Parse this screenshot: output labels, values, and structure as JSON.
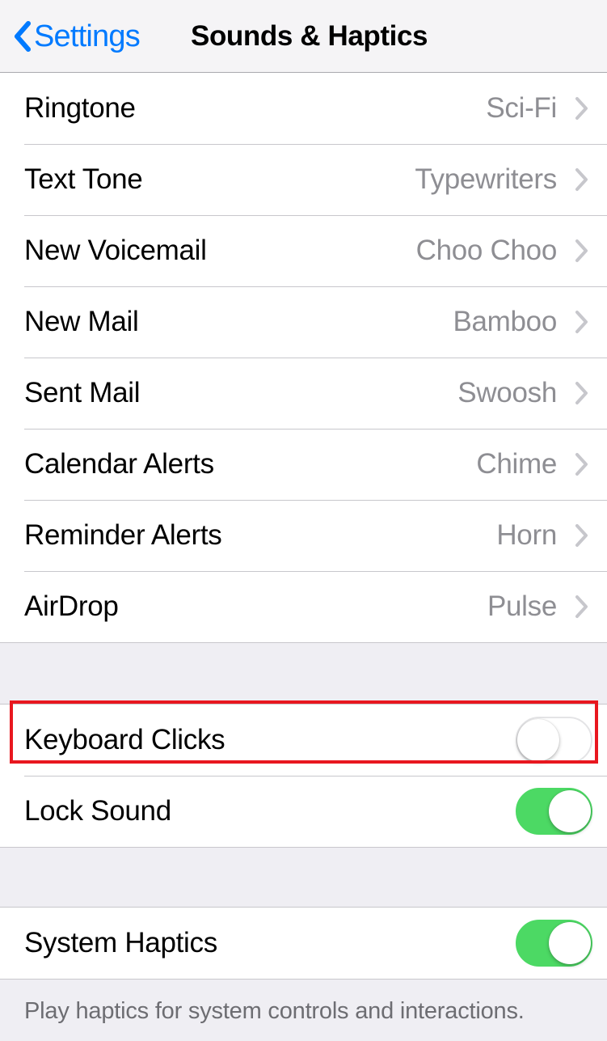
{
  "navbar": {
    "back_label": "Settings",
    "back_icon": "chevron-left-icon",
    "title": "Sounds & Haptics"
  },
  "colors": {
    "accent_blue": "#007AFF",
    "toggle_on_green": "#4CD964",
    "value_gray": "#8E8E93",
    "chevron_gray": "#C7C7CC",
    "group_background": "#EFEEF3",
    "separator": "#C8C7CC",
    "highlight_red": "#E8171F"
  },
  "sections": [
    {
      "name": "sounds-and-vibration-patterns",
      "rows": [
        {
          "label": "Ringtone",
          "value": "Sci-Fi",
          "accessory": "chevron-right-icon"
        },
        {
          "label": "Text Tone",
          "value": "Typewriters",
          "accessory": "chevron-right-icon"
        },
        {
          "label": "New Voicemail",
          "value": "Choo Choo",
          "accessory": "chevron-right-icon"
        },
        {
          "label": "New Mail",
          "value": "Bamboo",
          "accessory": "chevron-right-icon"
        },
        {
          "label": "Sent Mail",
          "value": "Swoosh",
          "accessory": "chevron-right-icon"
        },
        {
          "label": "Calendar Alerts",
          "value": "Chime",
          "accessory": "chevron-right-icon"
        },
        {
          "label": "Reminder Alerts",
          "value": "Horn",
          "accessory": "chevron-right-icon"
        },
        {
          "label": "AirDrop",
          "value": "Pulse",
          "accessory": "chevron-right-icon"
        }
      ]
    },
    {
      "name": "keyboard-and-lock-sounds",
      "rows": [
        {
          "label": "Keyboard Clicks",
          "toggle": "off",
          "highlighted": true
        },
        {
          "label": "Lock Sound",
          "toggle": "on",
          "highlighted": false
        }
      ]
    },
    {
      "name": "system-haptics",
      "rows": [
        {
          "label": "System Haptics",
          "toggle": "on",
          "highlighted": false
        }
      ],
      "footer": "Play haptics for system controls and interactions."
    }
  ]
}
